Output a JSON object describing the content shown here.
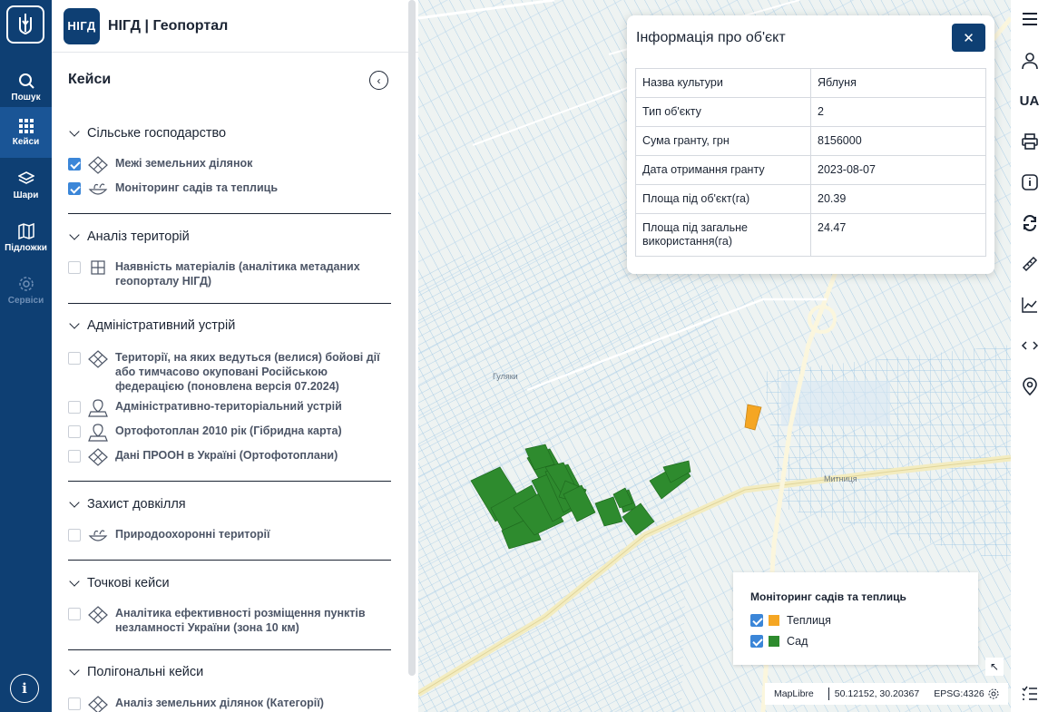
{
  "brand": {
    "logo_text": "НІГД",
    "title": "НІГД | Геопортал"
  },
  "rail": {
    "items": [
      {
        "label": "Пошук"
      },
      {
        "label": "Кейси"
      },
      {
        "label": "Шари"
      },
      {
        "label": "Підложки"
      },
      {
        "label": "Сервіси"
      }
    ],
    "info_glyph": "i"
  },
  "panel": {
    "title": "Кейси",
    "sections": [
      {
        "title": "Сільське господарство",
        "items": [
          {
            "label": "Межі земельних ділянок",
            "checked": true
          },
          {
            "label": "Моніторинг садів та теплиць",
            "checked": true
          }
        ]
      },
      {
        "title": "Аналіз територій",
        "items": [
          {
            "label": "Наявність матеріалів (аналітика метаданих геопорталу НІГД)",
            "checked": false
          }
        ]
      },
      {
        "title": "Адміністративний устрій",
        "items": [
          {
            "label": "Території, на яких ведуться (велися) бойові дії або тимчасово окуповані Російською федерацією (поновлена версія 07.2024)",
            "checked": false
          },
          {
            "label": "Адміністративно-територіальний устрій",
            "checked": false
          },
          {
            "label": "Ортофотоплан 2010 рік (Гібридна карта)",
            "checked": false
          },
          {
            "label": "Дані ПРООН в Україні (Ортофотоплани)",
            "checked": false
          }
        ]
      },
      {
        "title": "Захист довкілля",
        "items": [
          {
            "label": "Природоохоронні території",
            "checked": false
          }
        ]
      },
      {
        "title": "Точкові кейси",
        "items": [
          {
            "label": "Аналітика ефективності розміщення пунктів незламності України (зона 10 км)",
            "checked": false
          }
        ]
      },
      {
        "title": "Полігональні кейси",
        "items": [
          {
            "label": "Аналіз земельних ділянок (Категорії)",
            "checked": false
          }
        ]
      }
    ]
  },
  "map": {
    "place_labels": [
      "Гуляки",
      "Митниця"
    ],
    "popup": {
      "title": "Інформація про об'єкт",
      "close_glyph": "✕",
      "rows": [
        {
          "key": "Назва культури",
          "value": "Яблуня"
        },
        {
          "key": "Тип об'єкту",
          "value": "2"
        },
        {
          "key": "Сума гранту, грн",
          "value": "8156000"
        },
        {
          "key": "Дата отримання гранту",
          "value": "2023-08-07"
        },
        {
          "key": "Площа під об'єкт(га)",
          "value": "20.39"
        },
        {
          "key": "Площа під загальне використання(га)",
          "value": "24.47"
        }
      ]
    },
    "legend": {
      "title": "Моніторинг садів та теплиць",
      "items": [
        {
          "label": "Теплиця",
          "color": "#f5a623",
          "checked": true
        },
        {
          "label": "Сад",
          "color": "#2e8b2e",
          "checked": true
        }
      ]
    },
    "attribution": {
      "engine": "MapLibre",
      "coords": "50.12152, 30.20367",
      "crs": "EPSG:4326"
    }
  },
  "tools": {
    "lang": "UA"
  },
  "colors": {
    "primary": "#0e3f73",
    "orchard": "#2e8b2e",
    "greenhouse": "#f5a623",
    "parcel_line": "#9cc5e4"
  }
}
